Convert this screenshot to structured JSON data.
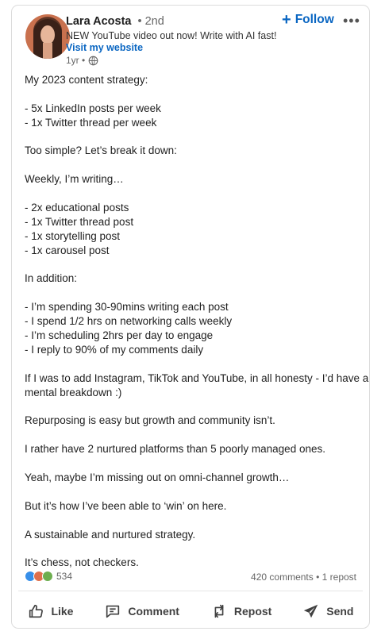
{
  "author": {
    "name": "Lara Acosta",
    "degree": "• 2nd",
    "headline": "NEW YouTube video out now! Write with AI fast!",
    "website_link": "Visit my website",
    "time": "1yr •"
  },
  "header": {
    "follow_label": "Follow",
    "more_label": "•••"
  },
  "post": {
    "lines": [
      "My 2023 content strategy:",
      "",
      "- 5x LinkedIn posts per week",
      "- 1x Twitter thread per week",
      "",
      "Too simple? Let’s break it down:",
      "",
      "Weekly, I’m writing…",
      "",
      "- 2x educational posts",
      "- 1x Twitter thread post",
      "- 1x storytelling post",
      "- 1x carousel post",
      "",
      "In addition:",
      "",
      "- I’m spending 30-90mins writing each post",
      "- I spend 1/2 hrs on networking calls weekly",
      "- I’m scheduling 2hrs per day to engage",
      "- I reply to 90% of my comments daily",
      "",
      "If I was to add Instagram, TikTok and YouTube, in all honesty - I’d have a",
      "mental breakdown :)",
      "",
      "Repurposing is easy but growth and community isn’t.",
      "",
      "I rather have 2 nurtured platforms than 5 poorly managed ones.",
      "",
      "Yeah, maybe I’m missing out on omni-channel growth…",
      "",
      "But it’s how I’ve been able to ‘win’ on here.",
      "",
      "A sustainable and nurtured strategy.",
      "",
      "It’s chess, not checkers."
    ]
  },
  "social": {
    "reaction_count": "534",
    "comments": "420 comments",
    "separator": "•",
    "reposts": "1 repost"
  },
  "actions": {
    "like": "Like",
    "comment": "Comment",
    "repost": "Repost",
    "send": "Send"
  },
  "colors": {
    "accent": "#0a66c2",
    "text": "#1f1f1f",
    "muted": "#666666"
  }
}
